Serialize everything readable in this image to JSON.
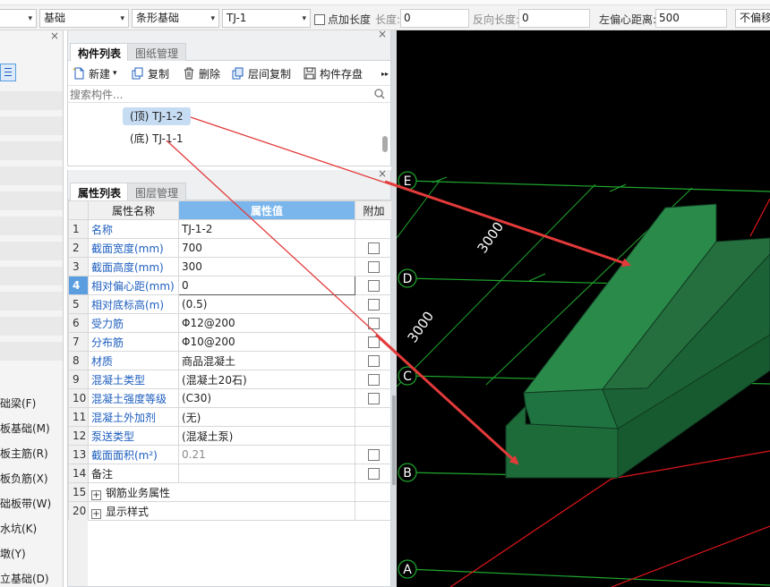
{
  "toolbar": {
    "dropdown1": "",
    "dropdown2": "基础",
    "dropdown3": "条形基础",
    "dropdown4": "TJ-1",
    "dropdown_arrow": "▾",
    "add_length_label": "点加长度",
    "length_label": "长度:",
    "length_value": "0",
    "reverse_length_label": "反向长度:",
    "reverse_length_value": "0",
    "left_offset_label": "左偏心距离:",
    "left_offset_value": "500",
    "no_offset_label": "不偏移"
  },
  "left_strip": {
    "items": [
      "础梁(F)",
      "板基础(M)",
      "板主筋(R)",
      "板负筋(X)",
      "础板带(W)",
      "水坑(K)",
      "墩(Y)",
      "立基础(D)"
    ]
  },
  "component_panel": {
    "tabs": [
      "构件列表",
      "图纸管理"
    ],
    "close": "×",
    "buttons": [
      "新建",
      "复制",
      "删除",
      "层间复制",
      "构件存盘"
    ],
    "more": "▸▸",
    "new_arrow": "▾",
    "search_placeholder": "搜索构件...",
    "tree": [
      {
        "label": "(顶) TJ-1-2",
        "selected": true
      },
      {
        "label": "(底) TJ-1-1",
        "selected": false
      }
    ]
  },
  "property_panel": {
    "tabs": [
      "属性列表",
      "图层管理"
    ],
    "close": "×",
    "headers": {
      "name": "属性名称",
      "value": "属性值",
      "extra": "附加"
    },
    "rows": [
      {
        "num": "1",
        "name": "名称",
        "value": "TJ-1-2"
      },
      {
        "num": "2",
        "name": "截面宽度(mm)",
        "value": "700"
      },
      {
        "num": "3",
        "name": "截面高度(mm)",
        "value": "300"
      },
      {
        "num": "4",
        "name": "相对偏心距(mm)",
        "value": "0"
      },
      {
        "num": "5",
        "name": "相对底标高(m)",
        "value": "(0.5)"
      },
      {
        "num": "6",
        "name": "受力筋",
        "value": "Φ12@200"
      },
      {
        "num": "7",
        "name": "分布筋",
        "value": "Φ10@200"
      },
      {
        "num": "8",
        "name": "材质",
        "value": "商品混凝土"
      },
      {
        "num": "9",
        "name": "混凝土类型",
        "value": "(混凝土20石)"
      },
      {
        "num": "10",
        "name": "混凝土强度等级",
        "value": "(C30)"
      },
      {
        "num": "11",
        "name": "混凝土外加剂",
        "value": "(无)"
      },
      {
        "num": "12",
        "name": "泵送类型",
        "value": "(混凝土泵)"
      },
      {
        "num": "13",
        "name": "截面面积(m²)",
        "value": "0.21"
      },
      {
        "num": "14",
        "name": "备注",
        "value": ""
      },
      {
        "num": "15",
        "name": "钢筋业务属性",
        "value": ""
      },
      {
        "num": "20",
        "name": "显示样式",
        "value": ""
      }
    ],
    "expand_symbol": "+"
  },
  "view3d": {
    "axis_labels": [
      "E",
      "D",
      "C",
      "B",
      "A"
    ],
    "dimensions": [
      "3000",
      "3000"
    ],
    "colors": {
      "grid": "#1fa82e",
      "red_axis": "#e0161c",
      "solid_front": "#1e6b3a",
      "solid_top": "#2a8a4a",
      "solid_side": "#185a30",
      "arrow": "#e33a3a"
    }
  }
}
